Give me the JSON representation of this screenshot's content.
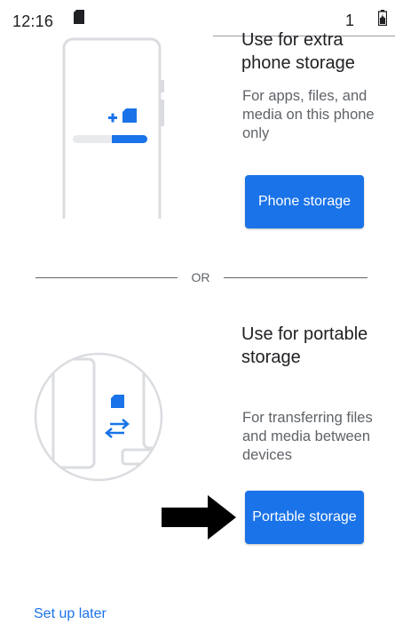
{
  "status_bar": {
    "time": "12:16",
    "notification_count": "1"
  },
  "phone_storage": {
    "title": "Use for extra phone storage",
    "description": "For apps, files, and media on this phone only",
    "button_label": "Phone storage"
  },
  "divider": {
    "label": "OR"
  },
  "portable_storage": {
    "title": "Use for portable storage",
    "description": "For transferring files and media between devices",
    "button_label": "Portable storage"
  },
  "footer": {
    "setup_later_label": "Set up later"
  },
  "colors": {
    "accent": "#1a73e8",
    "illustration_line": "#dadce0",
    "pointer_arrow": "#000000"
  }
}
